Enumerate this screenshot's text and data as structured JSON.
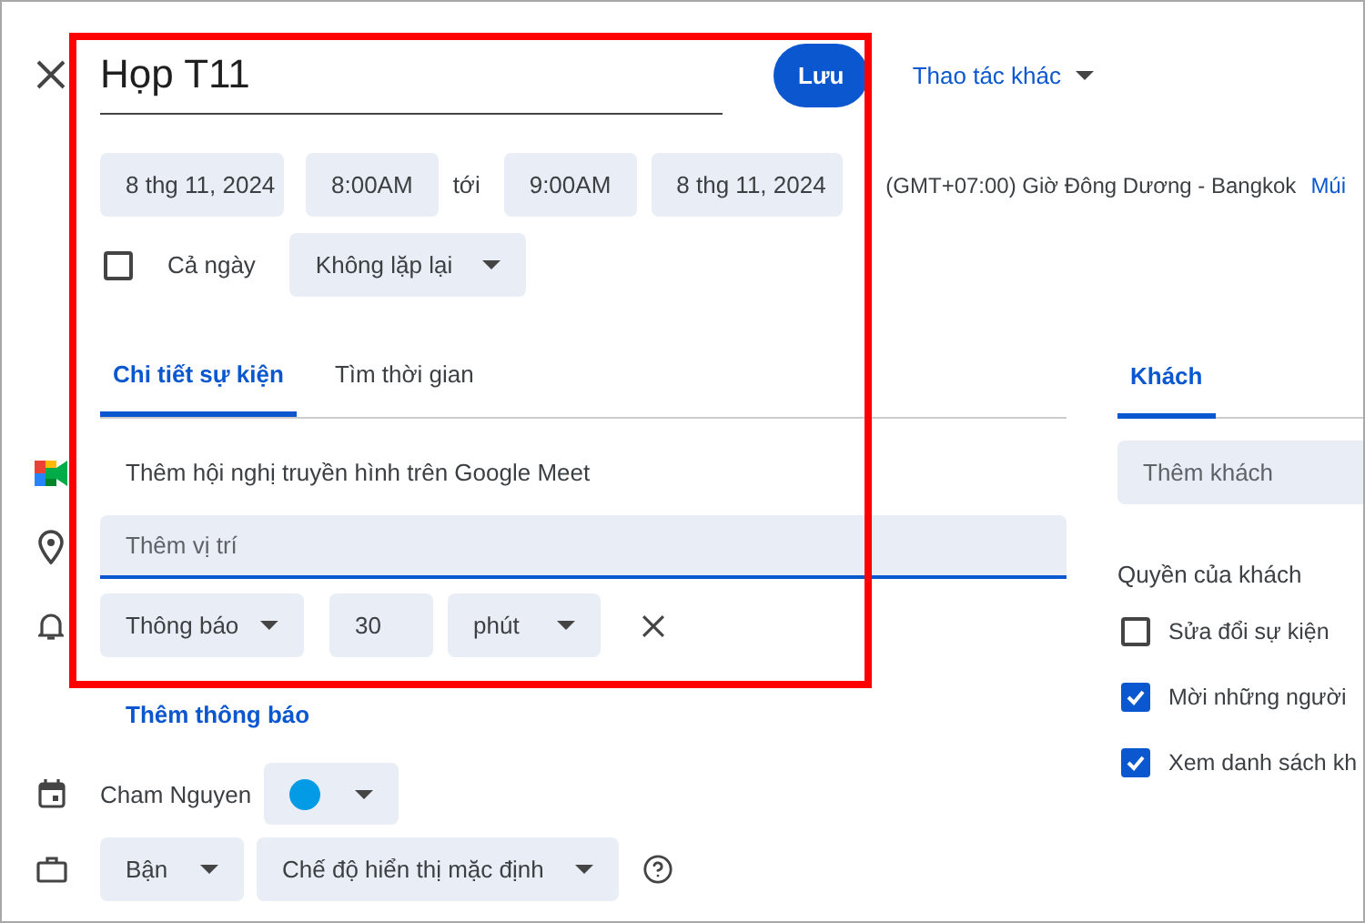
{
  "toolbar": {
    "title": "Họp T11",
    "save": "Lưu",
    "more_actions": "Thao tác khác"
  },
  "time_row": {
    "start_date": "8 thg 11, 2024",
    "start_time": "8:00AM",
    "separator": "tới",
    "end_time": "9:00AM",
    "end_date": "8 thg 11, 2024",
    "timezone": "(GMT+07:00) Giờ Đông Dương - Bangkok",
    "timezone_link": "Múi"
  },
  "all_day": {
    "label": "Cả ngày",
    "checked": false
  },
  "repeat": "Không lặp lại",
  "tabs": [
    {
      "label": "Chi tiết sự kiện",
      "selected": true
    },
    {
      "label": "Tìm thời gian",
      "selected": false
    }
  ],
  "details": {
    "meet": "Thêm hội nghị truyền hình trên Google Meet",
    "location": {
      "placeholder": "Thêm vị trí"
    },
    "notification": {
      "type": "Thông báo",
      "amount": "30",
      "unit": "phút"
    },
    "add_notification": "Thêm thông báo",
    "calendar": {
      "owner": "Cham Nguyen",
      "color": "#039be5"
    },
    "availability": "Bận",
    "visibility": "Chế độ hiển thị mặc định"
  },
  "guests": {
    "tab": {
      "label": "Khách",
      "selected": true
    },
    "add_guests": {
      "placeholder": "Thêm khách"
    },
    "permissions_title": "Quyền của khách",
    "permissions": [
      {
        "label": "Sửa đổi sự kiện",
        "checked": false
      },
      {
        "label": "Mời những người",
        "checked": true
      },
      {
        "label": "Xem danh sách kh",
        "checked": true
      }
    ]
  }
}
